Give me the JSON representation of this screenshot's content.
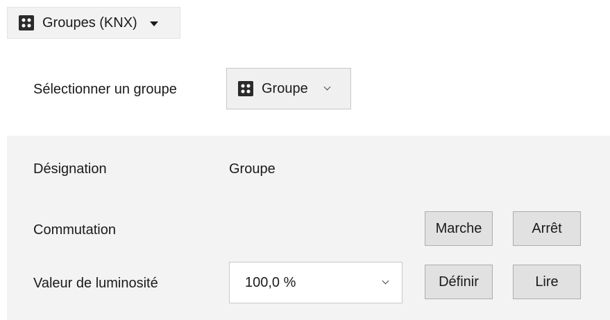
{
  "top_menu": {
    "label": "Groupes (KNX)",
    "icon": "dot-grid-icon"
  },
  "group_selector": {
    "label": "Sélectionner un groupe",
    "value": "Groupe",
    "icon": "dot-grid-icon"
  },
  "panel": {
    "designation_label": "Désignation",
    "designation_value": "Groupe",
    "switching_label": "Commutation",
    "on_button": "Marche",
    "off_button": "Arrêt",
    "brightness_label": "Valeur de luminosité",
    "brightness_value": "100,0 %",
    "set_button": "Définir",
    "read_button": "Lire"
  }
}
